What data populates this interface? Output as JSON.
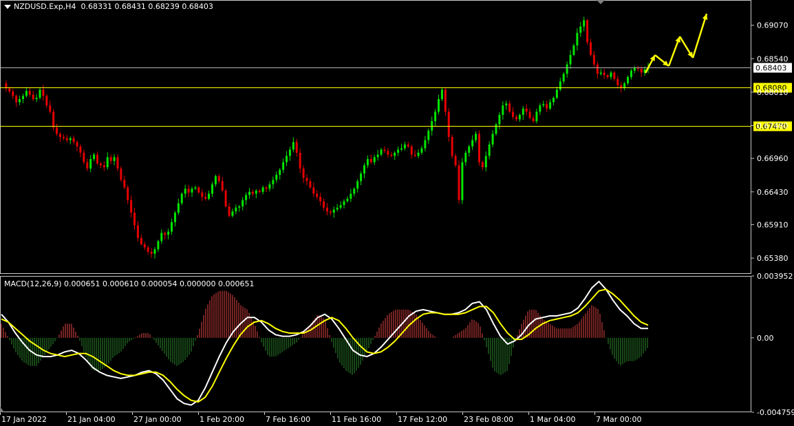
{
  "main_panel": {
    "symbol": "NZDUSD.Exp,H4",
    "ohlc": "0.68331 0.68431 0.68239 0.68403",
    "price_ticks": [
      "0.69070",
      "0.68540",
      "0.68010",
      "0.67480",
      "0.66960",
      "0.66430",
      "0.65910",
      "0.65380"
    ],
    "ylim": [
      0.6513,
      0.6947
    ],
    "horizontal_lines": [
      {
        "price": 0.68403,
        "label": "0.68403",
        "color": "#b4b4b4",
        "label_bg": "#ffffff",
        "label_color": "#000000"
      },
      {
        "price": 0.6808,
        "label": "0.68080",
        "color": "#ffff00",
        "label_bg": "#ffff00",
        "label_color": "#000000"
      },
      {
        "price": 0.6747,
        "label": "0.67470",
        "color": "#ffff00",
        "label_bg": "#ffff00",
        "label_color": "#000000"
      }
    ]
  },
  "macd_panel": {
    "label": "MACD(12,26,9) 0.000651 0.000610 0.000054 0.000000 0.000651",
    "ticks": [
      "0.003952",
      "0.00",
      "-0.004759"
    ],
    "ylim": [
      -0.004759,
      0.003952
    ]
  },
  "time_axis": [
    "17 Jan 2022",
    "21 Jan 04:00",
    "27 Jan 00:00",
    "1 Feb 20:00",
    "7 Feb 16:00",
    "11 Feb 16:00",
    "17 Feb 12:00",
    "23 Feb 08:00",
    "1 Mar 04:00",
    "7 Mar 00:00"
  ],
  "colors": {
    "bull": "#00e600",
    "bear": "#e60000",
    "line_main": "#ffffff",
    "line_signal": "#ffff00",
    "hist_pos": "#e64545",
    "hist_neg": "#2e8b2e",
    "grid": "#c8c8c8",
    "arrow": "#ffff00"
  },
  "chart_data": {
    "type": "candlestick",
    "x_labels": [
      "17 Jan 2022",
      "21 Jan 04:00",
      "27 Jan 00:00",
      "1 Feb 20:00",
      "7 Feb 16:00",
      "11 Feb 16:00",
      "17 Feb 12:00",
      "23 Feb 08:00",
      "1 Mar 04:00",
      "7 Mar 00:00"
    ],
    "price_path": [
      0.6815,
      0.6807,
      0.6802,
      0.6795,
      0.6785,
      0.679,
      0.6795,
      0.6803,
      0.6797,
      0.679,
      0.6792,
      0.6805,
      0.6795,
      0.678,
      0.677,
      0.6745,
      0.6735,
      0.673,
      0.6728,
      0.6725,
      0.6728,
      0.6722,
      0.6715,
      0.6705,
      0.669,
      0.668,
      0.6695,
      0.6702,
      0.6688,
      0.6685,
      0.6682,
      0.6698,
      0.6692,
      0.6698,
      0.668,
      0.6662,
      0.665,
      0.663,
      0.661,
      0.659,
      0.657,
      0.656,
      0.6555,
      0.6548,
      0.6545,
      0.6552,
      0.6565,
      0.6578,
      0.6575,
      0.658,
      0.6595,
      0.661,
      0.6625,
      0.664,
      0.6648,
      0.6642,
      0.6648,
      0.665,
      0.6642,
      0.6635,
      0.6632,
      0.664,
      0.6655,
      0.6668,
      0.666,
      0.6645,
      0.662,
      0.6605,
      0.6612,
      0.6618,
      0.662,
      0.663,
      0.6638,
      0.6643,
      0.664,
      0.6645,
      0.6643,
      0.665,
      0.6648,
      0.6655,
      0.6662,
      0.667,
      0.6678,
      0.669,
      0.67,
      0.671,
      0.6722,
      0.6705,
      0.668,
      0.6665,
      0.666,
      0.665,
      0.664,
      0.6635,
      0.6628,
      0.6618,
      0.6612,
      0.661,
      0.6615,
      0.6618,
      0.6622,
      0.6628,
      0.6632,
      0.664,
      0.6648,
      0.666,
      0.6672,
      0.6685,
      0.6695,
      0.669,
      0.6698,
      0.6702,
      0.671,
      0.6708,
      0.6702,
      0.67,
      0.6705,
      0.671,
      0.6712,
      0.6718,
      0.6715,
      0.6702,
      0.67,
      0.6705,
      0.6712,
      0.6725,
      0.674,
      0.6755,
      0.677,
      0.679,
      0.6805,
      0.677,
      0.673,
      0.67,
      0.6685,
      0.663,
      0.669,
      0.6705,
      0.6715,
      0.6725,
      0.6735,
      0.669,
      0.6682,
      0.67,
      0.6718,
      0.6735,
      0.675,
      0.6765,
      0.678,
      0.6783,
      0.677,
      0.6762,
      0.6758,
      0.6765,
      0.6775,
      0.677,
      0.676,
      0.6755,
      0.677,
      0.678,
      0.6782,
      0.6775,
      0.6785,
      0.6792,
      0.6805,
      0.6818,
      0.683,
      0.6845,
      0.686,
      0.6875,
      0.6895,
      0.6905,
      0.6915,
      0.688,
      0.686,
      0.6845,
      0.683,
      0.6832,
      0.6828,
      0.6825,
      0.6832,
      0.6822,
      0.6812,
      0.6808,
      0.6815,
      0.6825,
      0.6835,
      0.684,
      0.6838,
      0.6832,
      0.6837,
      0.684
    ],
    "macd_path": [
      0.0015,
      0.001,
      0.0003,
      -0.0003,
      -0.0008,
      -0.0011,
      -0.0012,
      -0.0012,
      -0.0011,
      -0.0009,
      -0.0008,
      -0.001,
      -0.0014,
      -0.0019,
      -0.0022,
      -0.0024,
      -0.0025,
      -0.0026,
      -0.0025,
      -0.0024,
      -0.0022,
      -0.0021,
      -0.0023,
      -0.0027,
      -0.0033,
      -0.0039,
      -0.0042,
      -0.0043,
      -0.004,
      -0.0032,
      -0.0022,
      -0.0012,
      -0.0003,
      0.0004,
      0.0009,
      0.0013,
      0.0013,
      0.001,
      0.0005,
      0.0002,
      0.0001,
      0.0001,
      0.0002,
      0.0004,
      0.0008,
      0.0013,
      0.0015,
      0.0012,
      0.0006,
      -0.0001,
      -0.0008,
      -0.0011,
      -0.0012,
      -0.001,
      -0.0006,
      -0.0001,
      0.0004,
      0.0009,
      0.0014,
      0.0017,
      0.0018,
      0.0017,
      0.0016,
      0.0015,
      0.0015,
      0.0016,
      0.0018,
      0.0022,
      0.0023,
      0.0018,
      0.0009,
      0.0001,
      -0.0004,
      -0.0002,
      0.0002,
      0.0008,
      0.0012,
      0.0013,
      0.0014,
      0.0014,
      0.0015,
      0.0016,
      0.0019,
      0.0025,
      0.0032,
      0.0036,
      0.0031,
      0.0024,
      0.0018,
      0.0014,
      0.0009,
      0.0006,
      0.0006
    ],
    "signal_path": [
      0.0012,
      0.001,
      0.0006,
      0.0002,
      -0.0002,
      -0.0005,
      -0.0008,
      -0.001,
      -0.0011,
      -0.0012,
      -0.0011,
      -0.001,
      -0.001,
      -0.0012,
      -0.0015,
      -0.0018,
      -0.0021,
      -0.0023,
      -0.0024,
      -0.0024,
      -0.0023,
      -0.0022,
      -0.0022,
      -0.0024,
      -0.0028,
      -0.0033,
      -0.0037,
      -0.004,
      -0.0041,
      -0.0038,
      -0.0031,
      -0.0022,
      -0.0013,
      -0.0005,
      0.0002,
      0.0007,
      0.001,
      0.0011,
      0.0009,
      0.0006,
      0.0004,
      0.0003,
      0.0003,
      0.0003,
      0.0005,
      0.0008,
      0.0011,
      0.0013,
      0.0011,
      0.0006,
      0.0,
      -0.0005,
      -0.0009,
      -0.001,
      -0.0009,
      -0.0006,
      -0.0002,
      0.0003,
      0.0008,
      0.0012,
      0.0015,
      0.0016,
      0.0016,
      0.0015,
      0.0015,
      0.0015,
      0.0016,
      0.0018,
      0.002,
      0.002,
      0.0016,
      0.0009,
      0.0003,
      -0.0001,
      -0.0001,
      0.0002,
      0.0006,
      0.0009,
      0.0011,
      0.0012,
      0.0013,
      0.0014,
      0.0016,
      0.002,
      0.0025,
      0.003,
      0.0031,
      0.0028,
      0.0024,
      0.0019,
      0.0014,
      0.001,
      0.0008
    ]
  }
}
